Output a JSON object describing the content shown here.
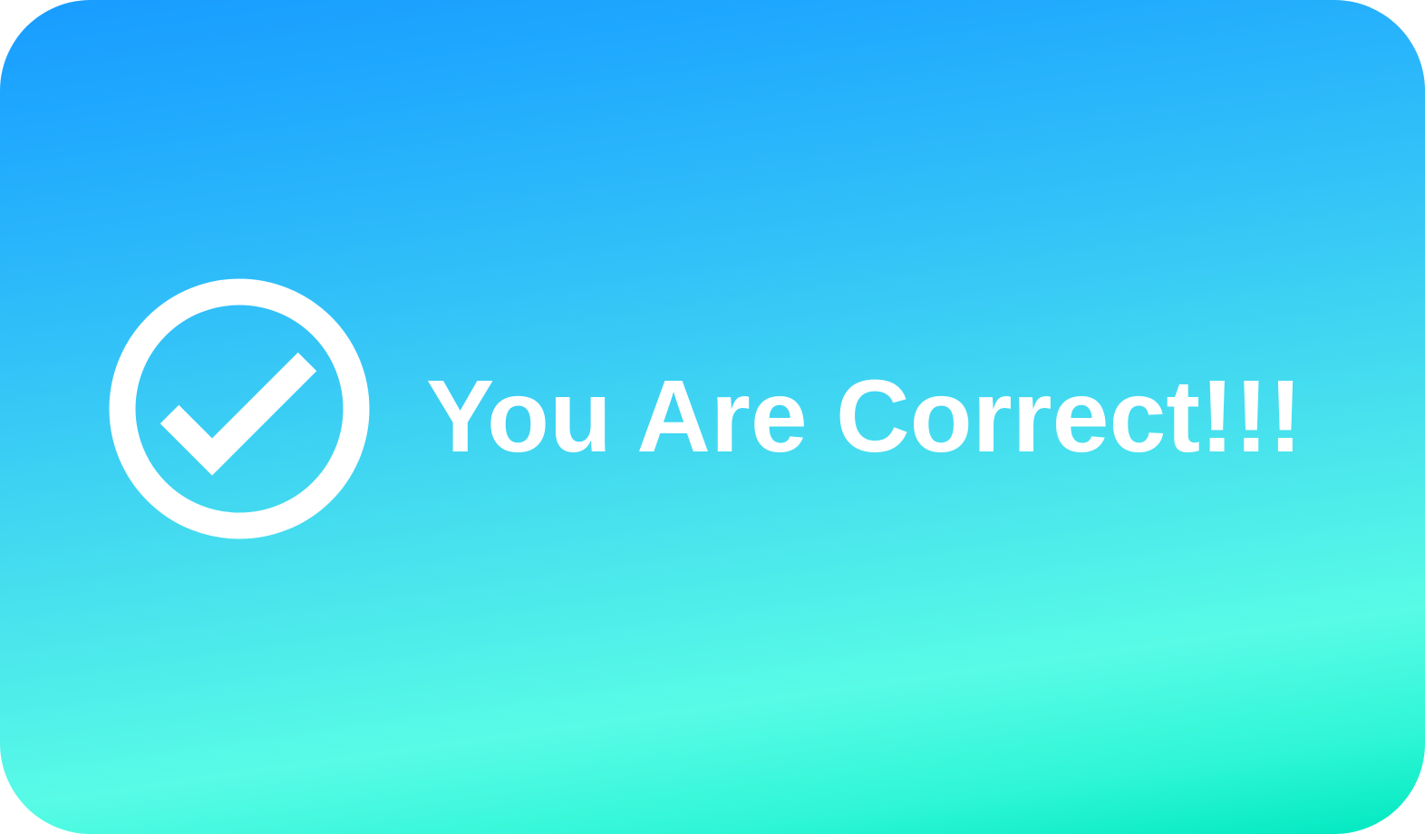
{
  "card": {
    "message": "You Are Correct!!!",
    "icon": "check-circle-icon",
    "colors": {
      "gradient_top": "#189CFF",
      "gradient_mid": "#58FBE6",
      "gradient_bottom": "#00E8C0",
      "foreground": "#FFFFFF"
    }
  }
}
